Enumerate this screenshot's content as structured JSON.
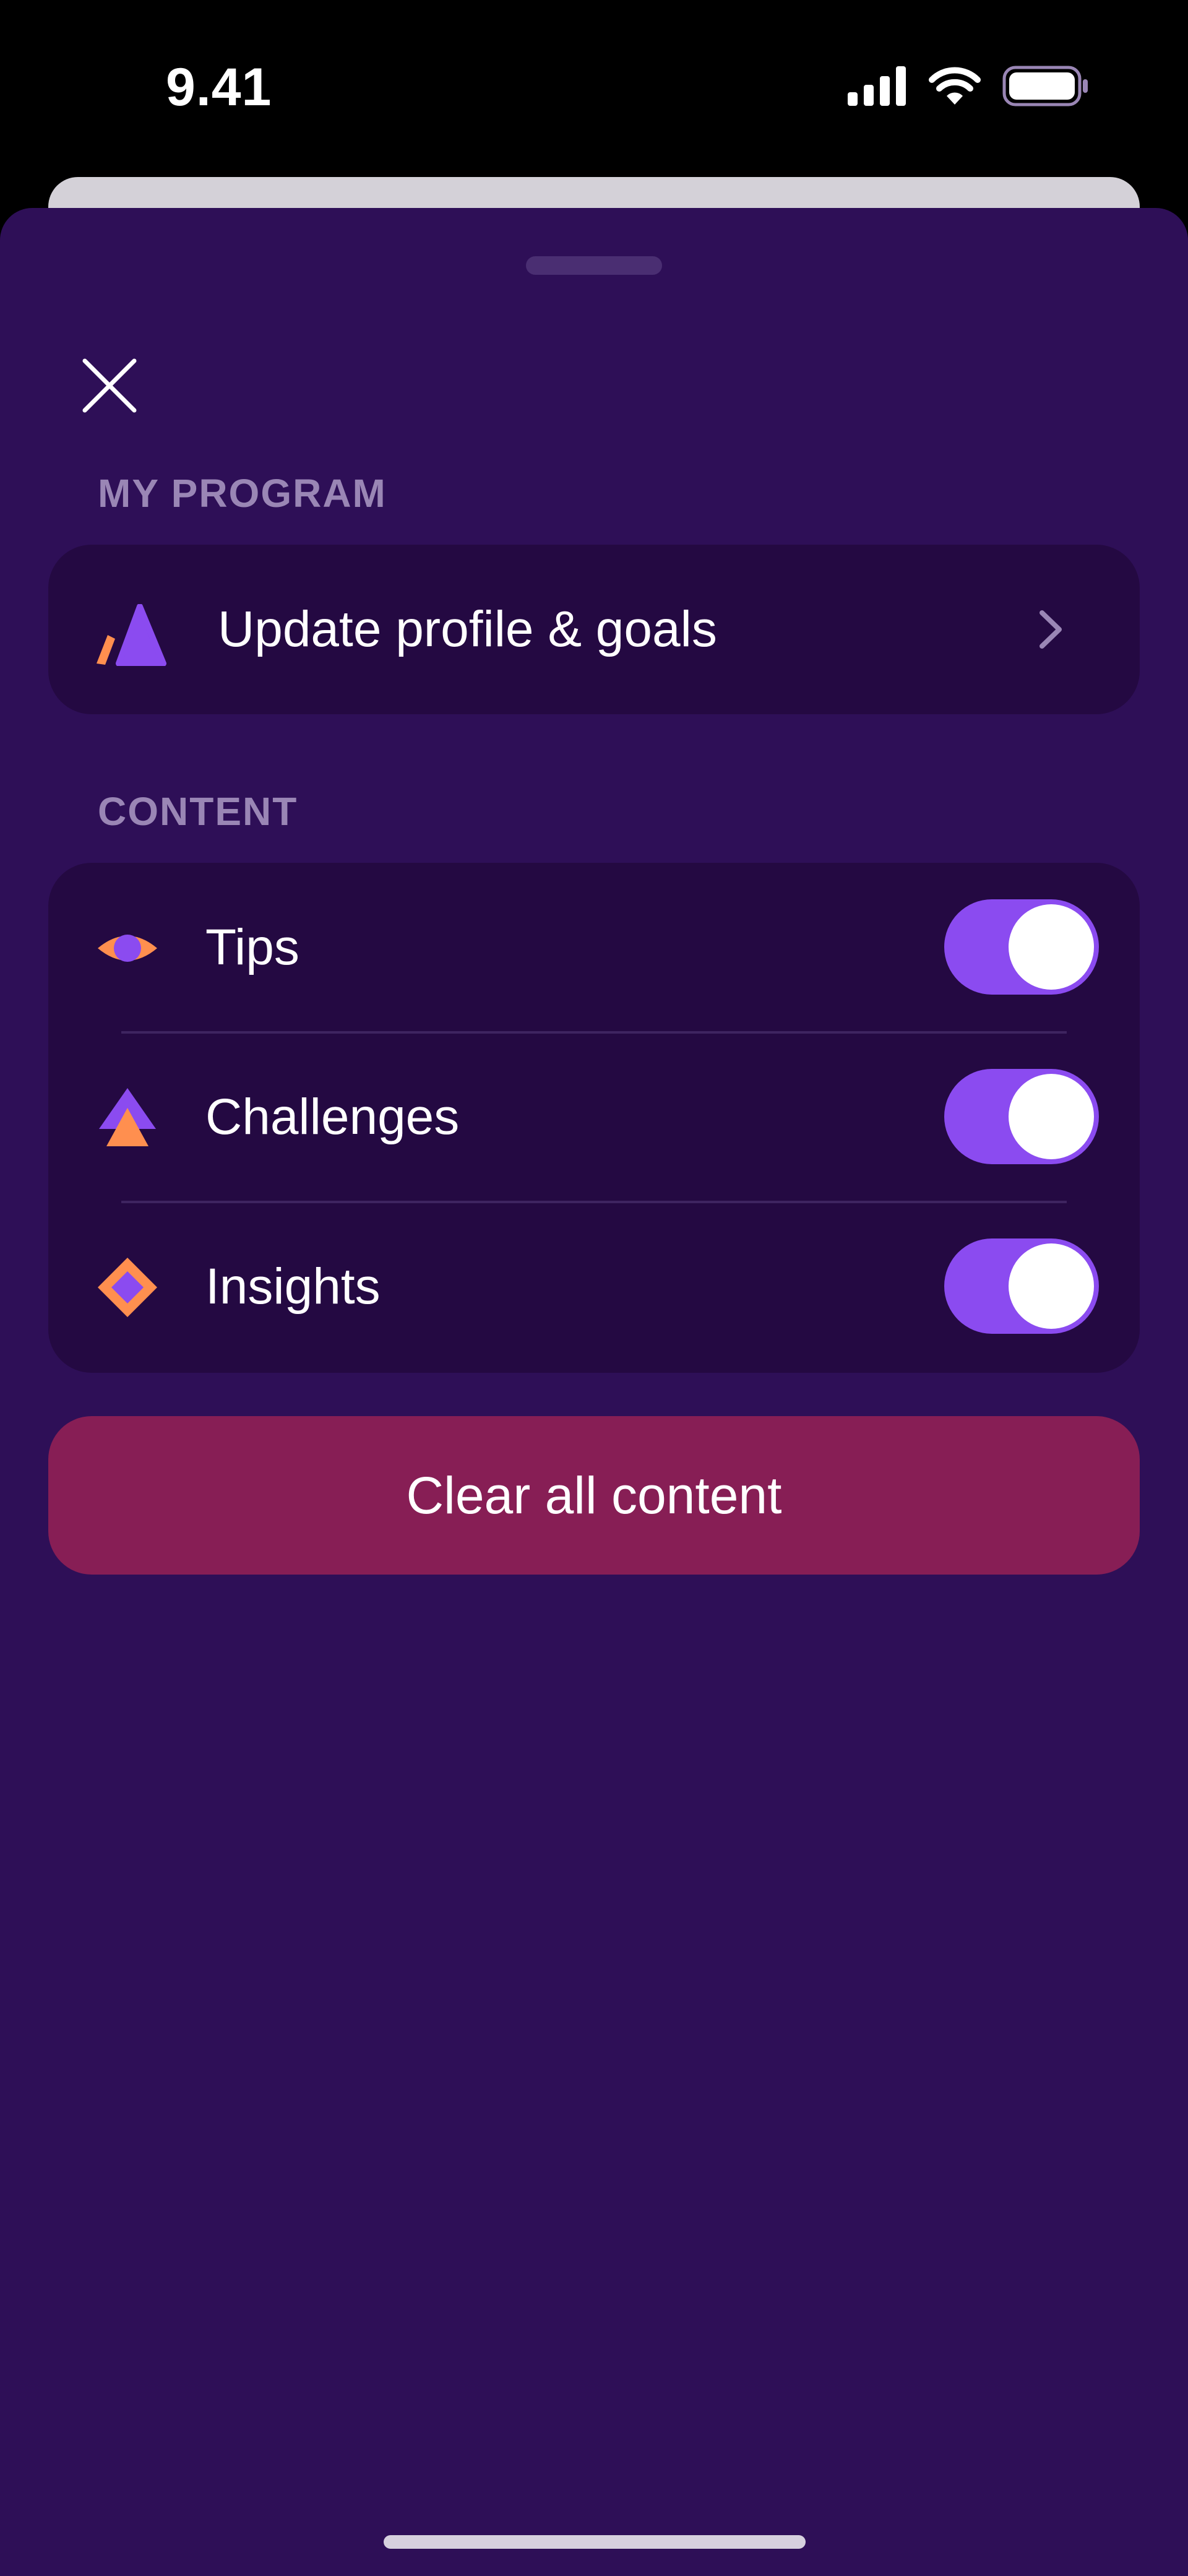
{
  "status_bar": {
    "time": "9.41",
    "icons": [
      "cellular-signal-icon",
      "wifi-icon",
      "battery-icon"
    ]
  },
  "sheet": {
    "close_icon": "close-icon",
    "sections": {
      "program": {
        "header": "MY PROGRAM",
        "item": {
          "label": "Update profile & goals",
          "icon": "profile-goals-icon",
          "trailing_icon": "chevron-right-icon"
        }
      },
      "content": {
        "header": "CONTENT",
        "items": [
          {
            "label": "Tips",
            "icon": "eye-icon",
            "enabled": true
          },
          {
            "label": "Challenges",
            "icon": "triangle-stack-icon",
            "enabled": true
          },
          {
            "label": "Insights",
            "icon": "diamond-icon",
            "enabled": true
          }
        ]
      }
    },
    "clear_button": "Clear all content"
  },
  "colors": {
    "sheet_background": "#2e0f57",
    "card_background": "#240942",
    "accent_purple": "#8b4bf0",
    "accent_orange": "#ff8f4f",
    "destructive": "#871e55",
    "section_header": "#9a86b5"
  }
}
